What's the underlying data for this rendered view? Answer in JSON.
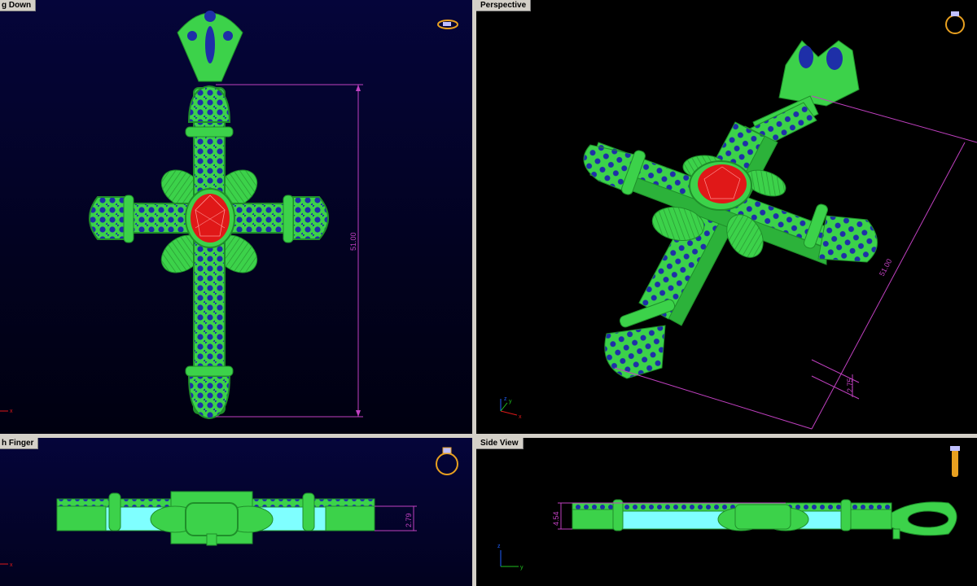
{
  "viewports": {
    "top": {
      "title": "g Down"
    },
    "persp": {
      "title": "Perspective"
    },
    "front": {
      "title": "h Finger"
    },
    "side": {
      "title": "Side View"
    }
  },
  "dimensions": {
    "top_length": "51.00",
    "persp_length": "51.00",
    "persp_thickness": "2.75",
    "front_thickness": "2.79",
    "side_thickness": "4.54"
  },
  "axes": {
    "x": "x",
    "y": "y",
    "z": "z"
  },
  "colors": {
    "metal": "#3cd24a",
    "metal_dark": "#1f8f2a",
    "stone_blue": "#1e2fa8",
    "gem_red": "#e01818",
    "dimension": "#c040c0",
    "cyan": "#7fffff",
    "gold_icon": "#e8a020"
  }
}
